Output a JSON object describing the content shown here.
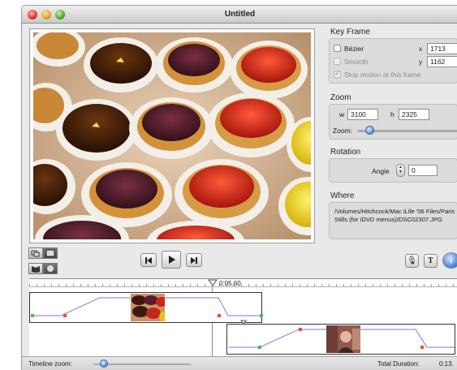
{
  "window": {
    "title": "Untitled"
  },
  "photo": {
    "description_icon": "photo-preview"
  },
  "key_frame": {
    "header": "Key Frame",
    "bezier_label": "Bézier",
    "smooth_label": "Smooth",
    "stop_label": "Stop motion at this frame",
    "x_label": "x",
    "x_value": "1713",
    "y_label": "y",
    "y_value": "1162"
  },
  "zoom": {
    "header": "Zoom",
    "w_label": "w",
    "w_value": "3100",
    "h_label": "h",
    "h_value": "2325",
    "zoom_label": "Zoom:"
  },
  "rotation": {
    "header": "Rotation",
    "angle_label": "Angle",
    "angle_value": "0"
  },
  "where": {
    "header": "Where",
    "path": "/Volumes/Hitchcock/Mac iLife '06 Files/Paris Stills (for iDVD menus)/DSC02307.JPG"
  },
  "controls": {
    "prev_icon": "previous-frame-icon",
    "play_icon": "play-icon",
    "next_icon": "next-frame-icon"
  },
  "timeline": {
    "playhead_time": "0:05.60",
    "zoom_label": "Timeline zoom:",
    "total_label": "Total Duration:",
    "total_value": "0:13."
  },
  "colors": {
    "accent": "#4f86d0",
    "keyframe_red": "#e8502c",
    "keyframe_green": "#4cbb3c",
    "curve": "#9a8ce6"
  }
}
